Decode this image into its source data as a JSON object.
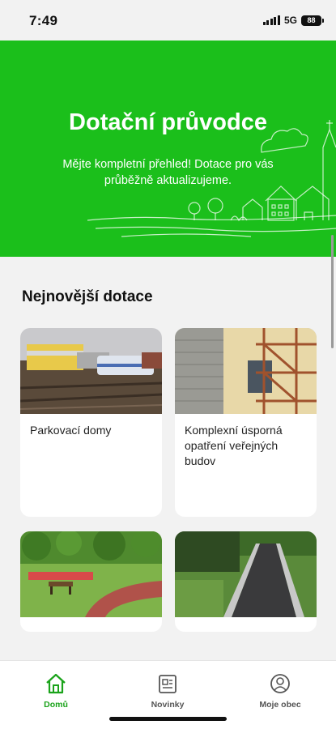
{
  "status_bar": {
    "time": "7:49",
    "network": "5G",
    "battery": "88"
  },
  "hero": {
    "title": "Dotační průvodce",
    "subtitle": "Mějte kompletní přehled! Dotace pro vás průběžně aktualizujeme."
  },
  "section": {
    "title": "Nejnovější dotace"
  },
  "cards": [
    {
      "title": "Parkovací domy"
    },
    {
      "title": "Komplexní úsporná opatření veřejných budov"
    },
    {
      "title": ""
    },
    {
      "title": ""
    }
  ],
  "tabbar": {
    "items": [
      {
        "label": "Domů",
        "icon": "home-icon",
        "active": true
      },
      {
        "label": "Novinky",
        "icon": "newspaper-icon",
        "active": false
      },
      {
        "label": "Moje obec",
        "icon": "user-circle-icon",
        "active": false
      }
    ]
  },
  "colors": {
    "brand_green": "#1bbf1b",
    "active_tab": "#1aa31a",
    "background": "#f2f2f2"
  }
}
